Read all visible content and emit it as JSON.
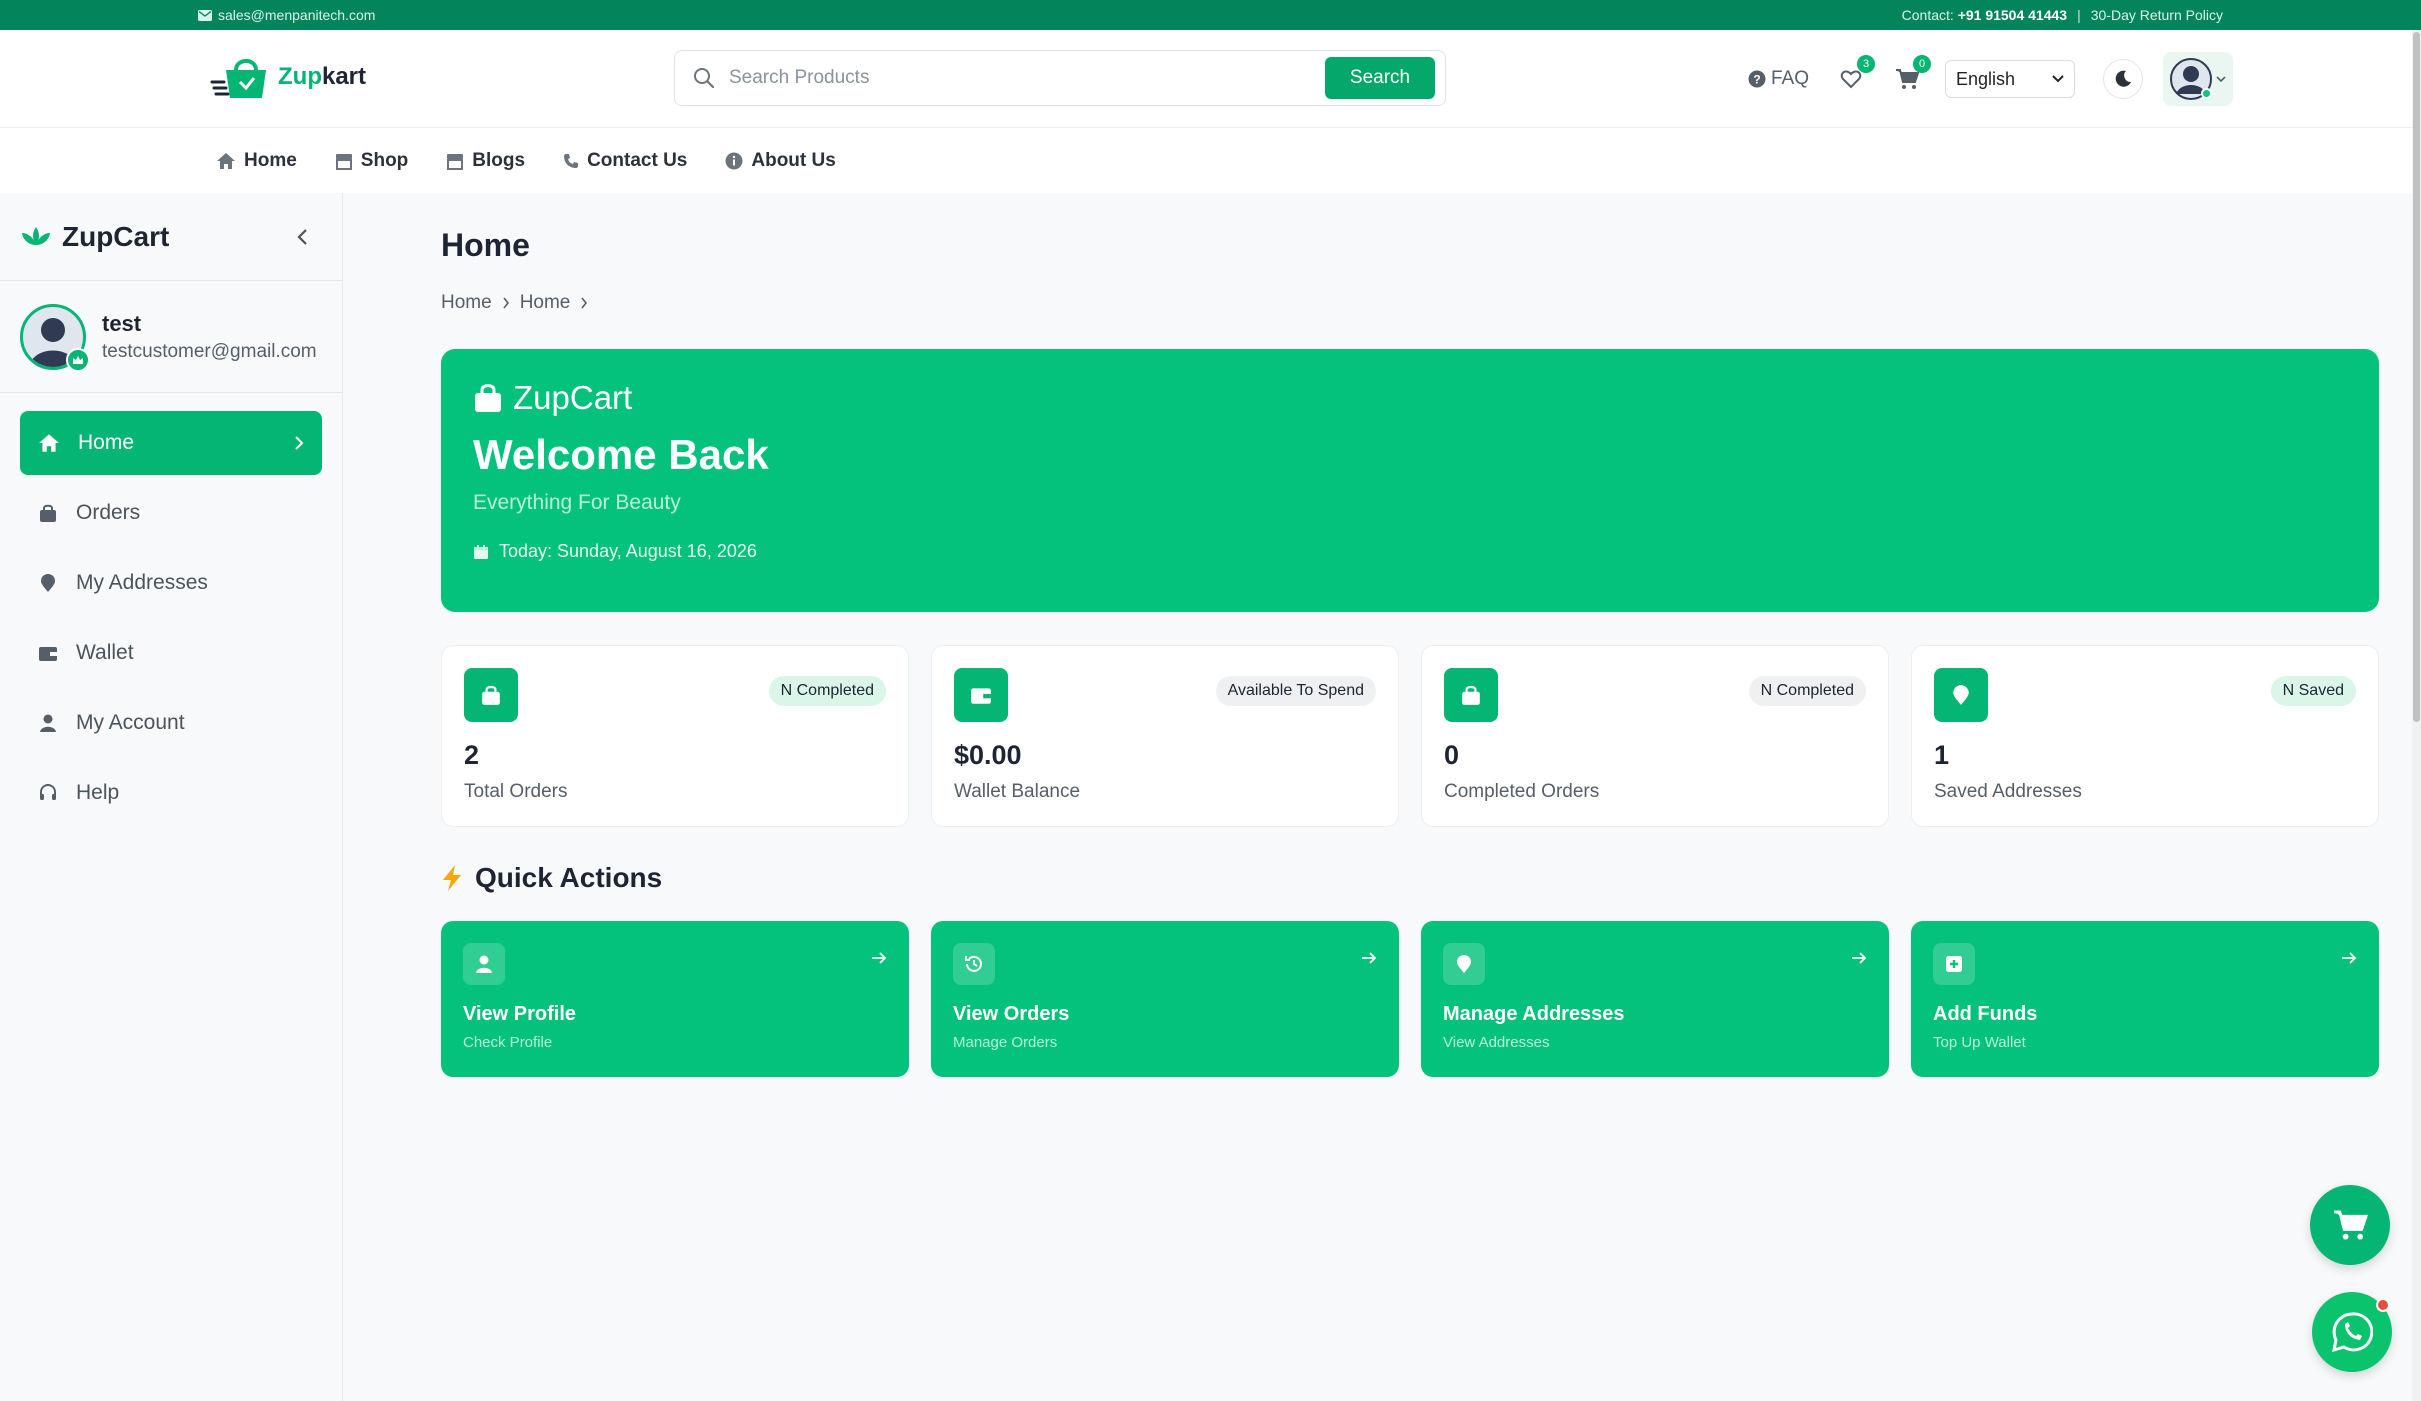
{
  "topbar": {
    "email": "sales@menpanitech.com",
    "contact_label": "Contact:",
    "contact_number": "+91 91504 41443",
    "separator": "|",
    "return_policy": "30-Day Return Policy"
  },
  "header": {
    "logo_zup": "Zup",
    "logo_kart": "kart",
    "search_placeholder": "Search Products",
    "search_button": "Search",
    "faq": "FAQ",
    "wishlist_count": "3",
    "cart_count": "0",
    "language": "English"
  },
  "nav": {
    "items": [
      {
        "label": "Home",
        "icon": "home-icon"
      },
      {
        "label": "Shop",
        "icon": "store-icon"
      },
      {
        "label": "Blogs",
        "icon": "blog-icon"
      },
      {
        "label": "Contact Us",
        "icon": "phone-icon"
      },
      {
        "label": "About Us",
        "icon": "info-icon"
      }
    ]
  },
  "sidebar": {
    "brand": "ZupCart",
    "user_name": "test",
    "user_email": "testcustomer@gmail.com",
    "items": [
      {
        "label": "Home",
        "icon": "home-icon",
        "active": true
      },
      {
        "label": "Orders",
        "icon": "bag-icon"
      },
      {
        "label": "My Addresses",
        "icon": "map-pin-icon"
      },
      {
        "label": "Wallet",
        "icon": "wallet-icon"
      },
      {
        "label": "My Account",
        "icon": "user-icon"
      },
      {
        "label": "Help",
        "icon": "headset-icon"
      }
    ]
  },
  "page": {
    "title": "Home",
    "breadcrumb": [
      "Home",
      "Home"
    ]
  },
  "hero": {
    "brand": "ZupCart",
    "welcome": "Welcome Back",
    "tagline": "Everything For Beauty",
    "date": "Today: Sunday, August 16, 2026"
  },
  "stats": [
    {
      "value": "2",
      "label": "Total Orders",
      "pill": "N Completed",
      "icon": "bag-icon"
    },
    {
      "value": "$0.00",
      "label": "Wallet Balance",
      "pill": "Available To Spend",
      "icon": "wallet-icon"
    },
    {
      "value": "0",
      "label": "Completed Orders",
      "pill": "N Completed",
      "icon": "bag-icon"
    },
    {
      "value": "1",
      "label": "Saved Addresses",
      "pill": "N Saved",
      "icon": "map-pin-icon"
    }
  ],
  "quick_actions": {
    "title": "Quick Actions",
    "items": [
      {
        "title": "View Profile",
        "subtitle": "Check Profile",
        "icon": "user-icon"
      },
      {
        "title": "View Orders",
        "subtitle": "Manage Orders",
        "icon": "history-icon"
      },
      {
        "title": "Manage Addresses",
        "subtitle": "View Addresses",
        "icon": "map-pin-icon"
      },
      {
        "title": "Add Funds",
        "subtitle": "Top Up Wallet",
        "icon": "plus-square-icon"
      }
    ]
  },
  "colors": {
    "brand_green": "#04c27b",
    "topbar_green": "#04845b",
    "accent": "#04b574"
  }
}
